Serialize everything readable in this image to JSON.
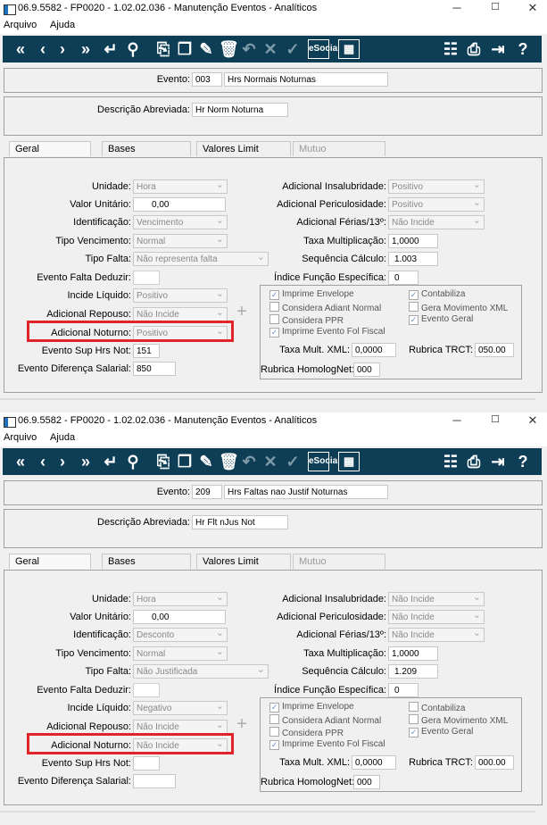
{
  "windows": [
    {
      "title": "06.9.5582 - FP0020 - 1.02.02.036 - Manutenção Eventos - Analíticos",
      "menu": [
        "Arquivo",
        "Ajuda"
      ],
      "evento_label": "Evento:",
      "evento_code": "003",
      "evento_name": "Hrs Normais Noturnas",
      "desc_label": "Descrição Abreviada:",
      "desc_value": "Hr Norm Noturna",
      "tabs": [
        "Geral",
        "Bases",
        "Valores Limit",
        "Mutuo"
      ],
      "left": {
        "unidade_label": "Unidade:",
        "unidade": "Hora",
        "valor_label": "Valor Unitário:",
        "valor": "0,00",
        "ident_label": "Identificação:",
        "ident": "Vencimento",
        "tipo_venc_label": "Tipo Vencimento:",
        "tipo_venc": "Normal",
        "tipo_falta_label": "Tipo Falta:",
        "tipo_falta": "Não representa falta",
        "falta_deduzir_label": "Evento Falta Deduzir:",
        "falta_deduzir": "",
        "incide_liq_label": "Incide Líquido:",
        "incide_liq": "Positivo",
        "adic_repouso_label": "Adicional Repouso:",
        "adic_repouso": "Não Incide",
        "adic_noturno_label": "Adicional Noturno:",
        "adic_noturno": "Positivo",
        "sup_hrs_label": "Evento Sup Hrs Not:",
        "sup_hrs": "151",
        "dif_sal_label": "Evento Diferença Salarial:",
        "dif_sal": "850"
      },
      "right": {
        "insal_label": "Adicional Insalubridade:",
        "insal": "Positivo",
        "peric_label": "Adicional Periculosidade:",
        "peric": "Positivo",
        "ferias_label": "Adicional Férias/13º:",
        "ferias": "Não Incide",
        "taxa_label": "Taxa Multiplicação:",
        "taxa": "1,0000",
        "seq_label": "Sequência Cálculo:",
        "seq": "1.003",
        "indice_label": "Índice Função Específica:",
        "indice": "0"
      },
      "checks": {
        "imprime_envelope": "Imprime Envelope",
        "contabiliza": "Contabiliza",
        "considera_adiant": "Considera Adiant Normal",
        "gera_xml": "Gera Movimento XML",
        "considera_ppr": "Considera PPR",
        "evento_geral": "Evento Geral",
        "imprime_fol": "Imprime Evento Fol Fiscal"
      },
      "checks_state": {
        "imprime_envelope": true,
        "contabiliza": true,
        "considera_adiant": false,
        "gera_xml": false,
        "considera_ppr": false,
        "evento_geral": true,
        "imprime_fol": true
      },
      "xml_label": "Taxa Mult. XML:",
      "xml": "0,0000",
      "trct_label": "Rubrica TRCT:",
      "trct": "050.00",
      "homolog_label": "Rubrica HomologNet:",
      "homolog": "000"
    },
    {
      "title": "06.9.5582 - FP0020 - 1.02.02.036 - Manutenção Eventos - Analíticos",
      "menu": [
        "Arquivo",
        "Ajuda"
      ],
      "evento_label": "Evento:",
      "evento_code": "209",
      "evento_name": "Hrs Faltas nao Justif Noturnas",
      "desc_label": "Descrição Abreviada:",
      "desc_value": "Hr Flt nJus Not",
      "tabs": [
        "Geral",
        "Bases",
        "Valores Limit",
        "Mutuo"
      ],
      "left": {
        "unidade_label": "Unidade:",
        "unidade": "Hora",
        "valor_label": "Valor Unitário:",
        "valor": "0,00",
        "ident_label": "Identificação:",
        "ident": "Desconto",
        "tipo_venc_label": "Tipo Vencimento:",
        "tipo_venc": "Normal",
        "tipo_falta_label": "Tipo Falta:",
        "tipo_falta": "Não Justificada",
        "falta_deduzir_label": "Evento Falta Deduzir:",
        "falta_deduzir": "",
        "incide_liq_label": "Incide Líquido:",
        "incide_liq": "Negativo",
        "adic_repouso_label": "Adicional Repouso:",
        "adic_repouso": "Não Incide",
        "adic_noturno_label": "Adicional Noturno:",
        "adic_noturno": "Não Incide",
        "sup_hrs_label": "Evento Sup Hrs Not:",
        "sup_hrs": "",
        "dif_sal_label": "Evento Diferença Salarial:",
        "dif_sal": ""
      },
      "right": {
        "insal_label": "Adicional Insalubridade:",
        "insal": "Não Incide",
        "peric_label": "Adicional Periculosidade:",
        "peric": "Não Incide",
        "ferias_label": "Adicional Férias/13º:",
        "ferias": "Não Incide",
        "taxa_label": "Taxa Multiplicação:",
        "taxa": "1,0000",
        "seq_label": "Sequência Cálculo:",
        "seq": "1.209",
        "indice_label": "Índice Função Específica:",
        "indice": "0"
      },
      "checks": {
        "imprime_envelope": "Imprime Envelope",
        "contabiliza": "Contabiliza",
        "considera_adiant": "Considera Adiant Normal",
        "gera_xml": "Gera Movimento XML",
        "considera_ppr": "Considera PPR",
        "evento_geral": "Evento Geral",
        "imprime_fol": "Imprime Evento Fol Fiscal"
      },
      "checks_state": {
        "imprime_envelope": true,
        "contabiliza": false,
        "considera_adiant": false,
        "gera_xml": false,
        "considera_ppr": false,
        "evento_geral": true,
        "imprime_fol": true
      },
      "xml_label": "Taxa Mult. XML:",
      "xml": "0,0000",
      "trct_label": "Rubrica TRCT:",
      "trct": "000.00",
      "homolog_label": "Rubrica HomologNet:",
      "homolog": "000"
    }
  ],
  "toolbar_icons": [
    "first-icon",
    "prev-icon",
    "next-icon",
    "last-icon",
    "return-icon",
    "search-icon",
    "new-icon",
    "copy-icon",
    "edit-icon",
    "delete-icon",
    "undo-icon",
    "cancel-icon",
    "confirm-icon",
    "esocial-icon",
    "calendar-icon",
    "tree-icon",
    "print-icon",
    "exit-icon",
    "help-icon"
  ],
  "toolbar_glyphs": {
    "esocial": "eSocial"
  },
  "colors": {
    "toolbar": "#0e3e56",
    "highlight": "#e0242b"
  }
}
